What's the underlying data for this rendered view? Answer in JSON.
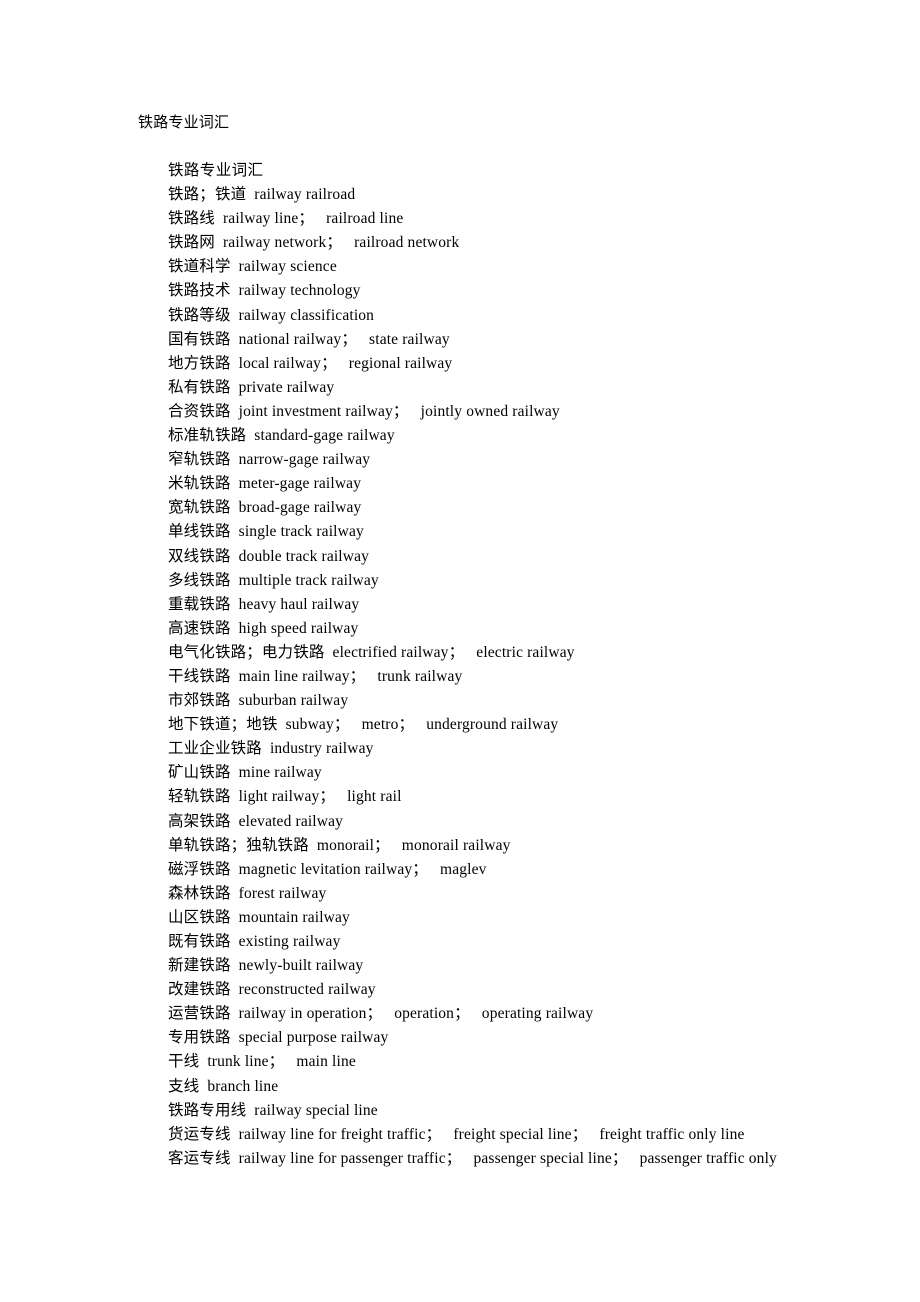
{
  "document": {
    "header_title": "铁路专业词汇",
    "section_title": "铁路专业词汇",
    "lines": [
      "铁路；铁道  railway railroad",
      "铁路线  railway line；   railroad line",
      "铁路网  railway network；   railroad network",
      "铁道科学  railway science",
      "铁路技术  railway technology",
      "铁路等级  railway classification",
      "国有铁路  national railway；   state railway",
      "地方铁路  local railway；   regional railway",
      "私有铁路  private railway",
      "合资铁路  joint investment railway；   jointly owned railway",
      "标准轨铁路  standard-gage railway",
      "窄轨铁路  narrow-gage railway",
      "米轨铁路  meter-gage railway",
      "宽轨铁路  broad-gage railway",
      "单线铁路  single track railway",
      "双线铁路  double track railway",
      "多线铁路  multiple track railway",
      "重载铁路  heavy haul railway",
      "高速铁路  high speed railway",
      "电气化铁路；电力铁路  electrified railway；   electric railway",
      "干线铁路  main line railway；   trunk railway",
      "市郊铁路  suburban railway",
      "地下铁道；地铁  subway；   metro；   underground railway",
      "工业企业铁路  industry railway",
      "矿山铁路  mine railway",
      "轻轨铁路  light railway；   light rail",
      "高架铁路  elevated railway",
      "单轨铁路；独轨铁路  monorail；   monorail railway",
      "磁浮铁路  magnetic levitation railway；   maglev",
      "森林铁路  forest railway",
      "山区铁路  mountain railway",
      "既有铁路  existing railway",
      "新建铁路  newly-built railway",
      "改建铁路  reconstructed railway",
      "运营铁路  railway in operation；   operation；   operating railway",
      "专用铁路  special purpose railway",
      "干线  trunk line；   main line",
      "支线  branch line",
      "铁路专用线  railway special line",
      "货运专线  railway line for freight traffic；   freight special line；   freight traffic only line",
      "客运专线  railway line for passenger traffic；   passenger special line；   passenger traffic only"
    ]
  }
}
